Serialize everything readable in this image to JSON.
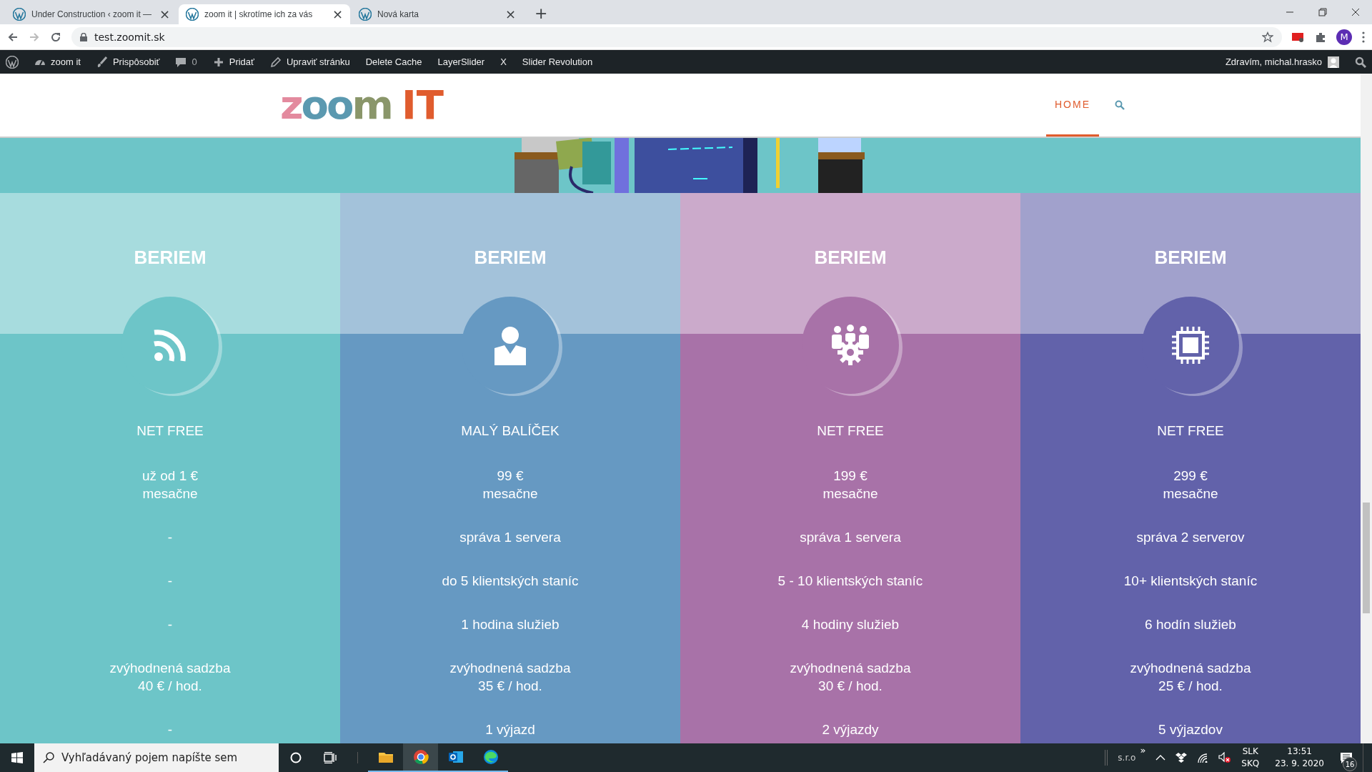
{
  "browser": {
    "tabs": [
      {
        "title": "Under Construction ‹ zoom it —",
        "selected": false,
        "close": "×"
      },
      {
        "title": "zoom it | skrotíme ich za vás",
        "selected": true,
        "close": "×"
      },
      {
        "title": "Nová karta",
        "selected": false,
        "close": "×"
      }
    ],
    "new_tab": "+",
    "address": "test.zoomit.sk",
    "profile": "M"
  },
  "admin_bar": {
    "items": [
      {
        "kind": "dashboard",
        "label": "zoom it"
      },
      {
        "kind": "brush",
        "label": "Prispôsobiť"
      },
      {
        "kind": "comments",
        "label": "0"
      },
      {
        "kind": "plus",
        "label": "Pridať"
      },
      {
        "kind": "pencil",
        "label": "Upraviť stránku"
      },
      {
        "kind": "text",
        "label": "Delete Cache"
      },
      {
        "kind": "text",
        "label": "LayerSlider"
      },
      {
        "kind": "text",
        "label": "X"
      },
      {
        "kind": "text",
        "label": "Slider Revolution"
      }
    ],
    "greeting": "Zdravím, michal.hrasko"
  },
  "site_header": {
    "logo": {
      "part_1": "zoom",
      "part_2": "IT"
    },
    "nav": [
      {
        "label": "HOME",
        "selected": true
      }
    ]
  },
  "columns": [
    {
      "title": "BERIEM",
      "color": "#6dc5c8",
      "package": "NET FREE",
      "price": "už od 1 €\nmesačne",
      "rows": [
        "-",
        "-",
        "-",
        "zvýhodnená sadzba\n40 € / hod.",
        "-"
      ]
    },
    {
      "title": "BERIEM",
      "color": "#6699c2",
      "package": "MALÝ BALÍČEK",
      "price": "99 €\nmesačne",
      "rows": [
        "správa 1 servera",
        "do 5 klientských staníc",
        "1 hodina služieb",
        "zvýhodnená sadzba\n35 € / hod.",
        "1 výjazd"
      ]
    },
    {
      "title": "BERIEM",
      "color": "#a872a8",
      "package": "NET FREE",
      "price": "199 €\nmesačne",
      "rows": [
        "správa 1 servera",
        "5 - 10 klientských staníc",
        "4 hodiny služieb",
        "zvýhodnená sadzba\n30 € / hod.",
        "2 výjazdy"
      ]
    },
    {
      "title": "BERIEM",
      "color": "#6262aa",
      "package": "NET FREE",
      "price": "299 €\nmesačne",
      "rows": [
        "správa 2 serverov",
        "10+ klientských staníc",
        "6 hodín služieb",
        "zvýhodnená sadzba\n25 € / hod.",
        "5 výjazdov"
      ]
    }
  ],
  "taskbar": {
    "search": {
      "placeholder": "Vyhľadávaný pojem napíšte sem"
    },
    "apps": [
      {
        "kind": "explorer",
        "selected": false
      },
      {
        "kind": "chrome",
        "selected": true
      },
      {
        "kind": "outlook",
        "selected": false
      },
      {
        "kind": "edge",
        "selected": false
      }
    ],
    "tray_label": "s.r.o",
    "tray_more": "»",
    "language": "SLK",
    "layout": "SKQ",
    "time": "13:51",
    "date": "23. 9. 2020",
    "notifications": "16"
  }
}
